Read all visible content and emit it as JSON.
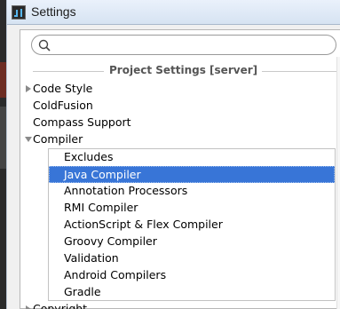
{
  "window": {
    "title": "Settings",
    "colors": {
      "selection": "#3875d7",
      "titlebar": "#dbe6f3"
    }
  },
  "search": {
    "value": "",
    "placeholder": ""
  },
  "section": {
    "label": "Project Settings [server]"
  },
  "tree": {
    "top_items": [
      {
        "label": "Code Style",
        "expander": "collapsed"
      },
      {
        "label": "ColdFusion",
        "expander": "none"
      },
      {
        "label": "Compass Support",
        "expander": "none"
      },
      {
        "label": "Compiler",
        "expander": "expanded"
      }
    ],
    "compiler_children": [
      {
        "label": "Excludes",
        "selected": false
      },
      {
        "label": "Java Compiler",
        "selected": true
      },
      {
        "label": "Annotation Processors",
        "selected": false
      },
      {
        "label": "RMI Compiler",
        "selected": false
      },
      {
        "label": "ActionScript & Flex Compiler",
        "selected": false
      },
      {
        "label": "Groovy Compiler",
        "selected": false
      },
      {
        "label": "Validation",
        "selected": false
      },
      {
        "label": "Android Compilers",
        "selected": false
      },
      {
        "label": "Gradle",
        "selected": false
      }
    ],
    "bottom_item": {
      "label": "Copyright",
      "expander": "collapsed"
    }
  },
  "icons": {
    "app": "intellij-idea-icon",
    "search": "search-icon",
    "collapsed": "triangle-right-icon",
    "expanded": "triangle-down-icon"
  }
}
